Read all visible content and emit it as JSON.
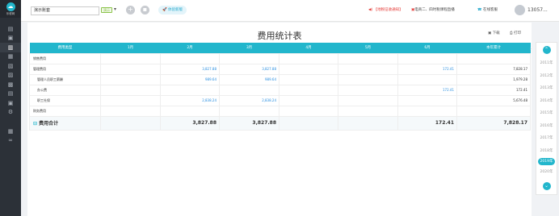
{
  "sidebar": {
    "logo_text": "乐税网",
    "icons": [
      "receipt-icon",
      "invoice-icon",
      "chart-icon",
      "document-icon",
      "wallet-icon",
      "book-icon",
      "cart-icon",
      "printer-icon",
      "report-icon",
      "settings-icon",
      "calculator-icon",
      "link-icon"
    ]
  },
  "topbar": {
    "company": "演示账套",
    "badge": "演示",
    "trial_label": "体验新版",
    "notice": "【地税征收通知】",
    "live": "电商二、四时税课程直播",
    "service": "在线客服",
    "user": "1305",
    "user_suffix": "7..."
  },
  "main": {
    "title": "费用统计表",
    "download": "下载",
    "print": "打印"
  },
  "table": {
    "headers": [
      "费用类型",
      "1月",
      "2月",
      "3月",
      "4月",
      "5月",
      "6月",
      "本年累计"
    ],
    "rows": [
      {
        "name": "销售费用",
        "sub": false,
        "cells": [
          "",
          "",
          "",
          "",
          "",
          "",
          ""
        ]
      },
      {
        "name": "管理费用",
        "sub": false,
        "cells": [
          "",
          "3,827.88",
          "3,827.88",
          "",
          "",
          "172.41",
          "7,828.17"
        ]
      },
      {
        "name": "管理人员职工薪酬",
        "sub": true,
        "cells": [
          "",
          "989.64",
          "989.64",
          "",
          "",
          "",
          "1,979.28"
        ]
      },
      {
        "name": "办公费",
        "sub": true,
        "cells": [
          "",
          "",
          "",
          "",
          "",
          "172.41",
          "172.41"
        ]
      },
      {
        "name": "职工社保",
        "sub": true,
        "cells": [
          "",
          "2,838.24",
          "2,838.24",
          "",
          "",
          "",
          "5,676.48"
        ]
      },
      {
        "name": "财务费用",
        "sub": false,
        "cells": [
          "",
          "",
          "",
          "",
          "",
          "",
          ""
        ]
      }
    ],
    "total": {
      "name": "费用合计",
      "cells": [
        "",
        "3,827.88",
        "3,827.88",
        "",
        "",
        "172.41",
        "7,828.17"
      ]
    }
  },
  "years": [
    "2011年",
    "2012年",
    "2013年",
    "2014年",
    "2015年",
    "2016年",
    "2017年",
    "2018年",
    "2019年",
    "2020年"
  ],
  "active_year": "2019年",
  "colors": {
    "accent": "#22b6cc",
    "value_blue": "#2a8fe0",
    "notice_red": "#e53935"
  }
}
